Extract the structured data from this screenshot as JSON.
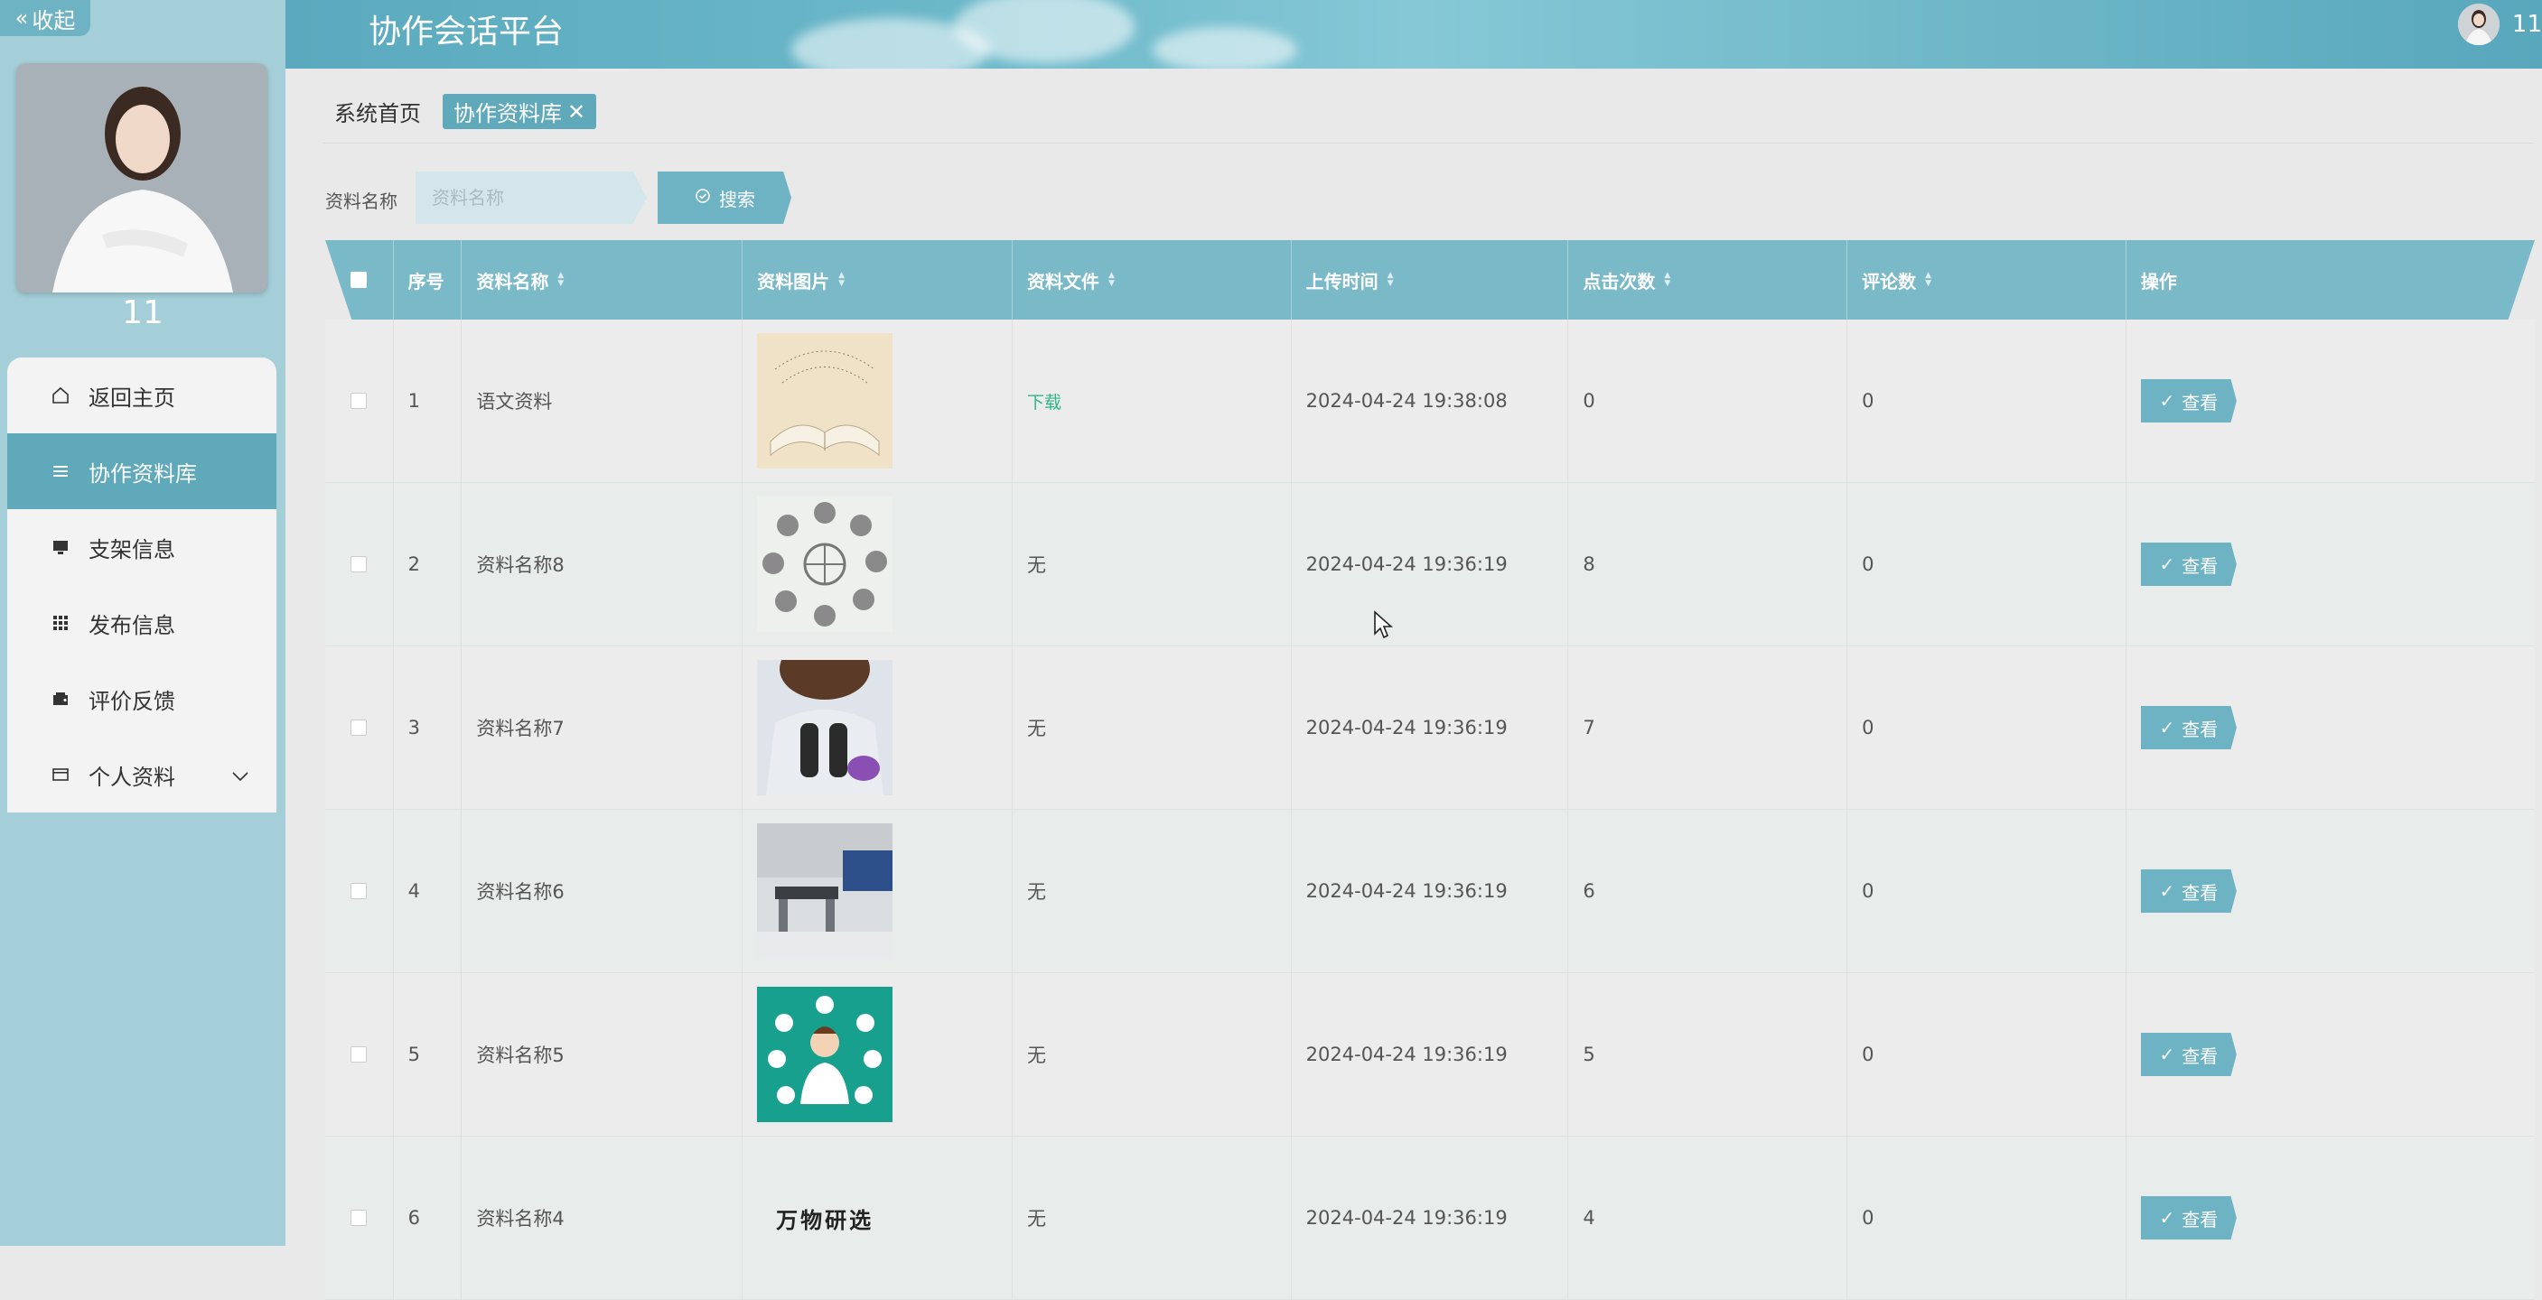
{
  "app_title": "协作会话平台",
  "header": {
    "username": "11"
  },
  "sidebar": {
    "collapse_label": "收起",
    "user_name": "11",
    "items": [
      {
        "label": "返回主页",
        "icon": "home-icon"
      },
      {
        "label": "协作资料库",
        "icon": "list-icon",
        "active": true
      },
      {
        "label": "支架信息",
        "icon": "monitor-icon"
      },
      {
        "label": "发布信息",
        "icon": "grid-icon"
      },
      {
        "label": "评价反馈",
        "icon": "wallet-icon"
      },
      {
        "label": "个人资料",
        "icon": "card-icon"
      }
    ]
  },
  "tabs": [
    {
      "label": "系统首页"
    },
    {
      "label": "协作资料库",
      "active": true,
      "close": "✕"
    }
  ],
  "search": {
    "label": "资料名称",
    "placeholder": "资料名称",
    "button": "搜索"
  },
  "table": {
    "headers": [
      "序号",
      "资料名称",
      "资料图片",
      "资料文件",
      "上传时间",
      "点击次数",
      "评论数",
      "操作"
    ],
    "view_label": "查看",
    "rows": [
      {
        "index": "1",
        "name": "语文资料",
        "image": "open-book-image",
        "file": "下载",
        "file_is_link": true,
        "time": "2024-04-24 19:38:08",
        "clicks": "0",
        "comments": "0"
      },
      {
        "index": "2",
        "name": "资料名称8",
        "image": "science-icons-circle-image",
        "file": "无",
        "time": "2024-04-24 19:36:19",
        "clicks": "8",
        "comments": "0"
      },
      {
        "index": "3",
        "name": "资料名称7",
        "image": "microscope-researcher-image",
        "file": "无",
        "time": "2024-04-24 19:36:19",
        "clicks": "7",
        "comments": "0"
      },
      {
        "index": "4",
        "name": "资料名称6",
        "image": "laboratory-room-image",
        "file": "无",
        "time": "2024-04-24 19:36:19",
        "clicks": "6",
        "comments": "0"
      },
      {
        "index": "5",
        "name": "资料名称5",
        "image": "scientist-illustration-image",
        "file": "无",
        "time": "2024-04-24 19:36:19",
        "clicks": "5",
        "comments": "0"
      },
      {
        "index": "6",
        "name": "资料名称4",
        "image": "calligraphy-text-image",
        "image_text": "万物研选",
        "file": "无",
        "time": "2024-04-24 19:36:19",
        "clicks": "4",
        "comments": "0"
      }
    ]
  }
}
